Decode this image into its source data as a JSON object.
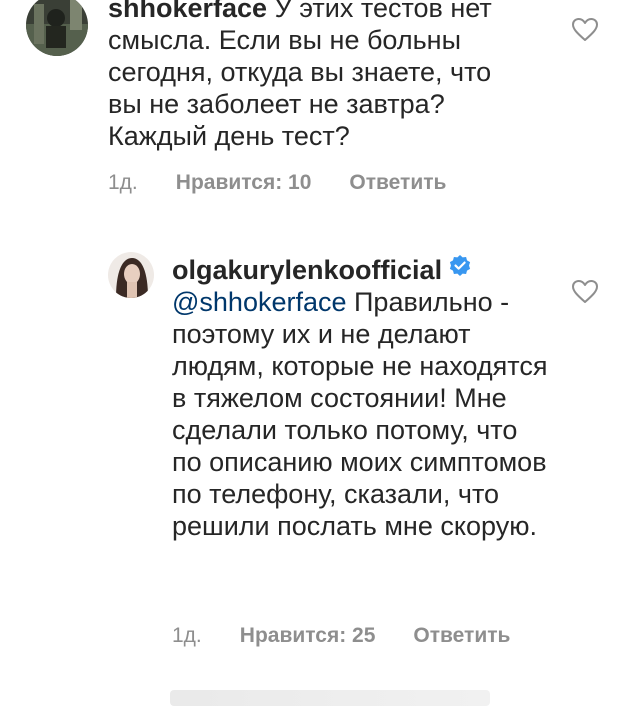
{
  "comments": [
    {
      "username": "shhokerface",
      "text": "У этих тестов нет смысла. Если вы не больны сегодня, откуда вы знаете, что вы не заболеет не завтра? Каждый день тест?",
      "time": "1д.",
      "likes": "Нравится: 10",
      "reply": "Ответить"
    },
    {
      "username": "olgakurylenkoofficial",
      "verified": true,
      "mention": "@shhokerface",
      "text": "Правильно - поэтому их и не делают людям, которые не находятся в тяжелом состоянии! Мне сделали только потому, что по описанию моих симптомов по телефону, сказали, что решили послать мне скорую.",
      "time": "1д.",
      "likes": "Нравится: 25",
      "reply": "Ответить"
    }
  ],
  "colors": {
    "text": "#262626",
    "meta": "#8e8e8e",
    "mention": "#00376b",
    "verified": "#3897f0"
  }
}
